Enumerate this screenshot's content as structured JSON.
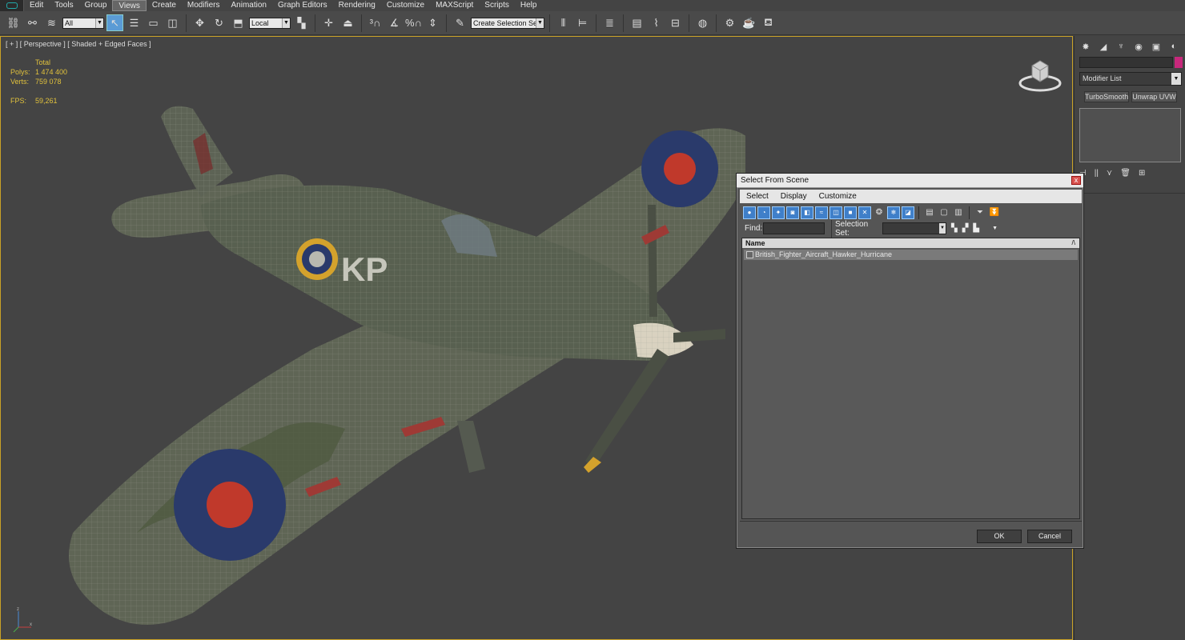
{
  "menu": {
    "items": [
      "Edit",
      "Tools",
      "Group",
      "Views",
      "Create",
      "Modifiers",
      "Animation",
      "Graph Editors",
      "Rendering",
      "Customize",
      "MAXScript",
      "Scripts",
      "Help"
    ],
    "active": "Views"
  },
  "toolbar": {
    "selection_filter": "All",
    "reference_coord": "Local",
    "selection_set_placeholder": "Create Selection Se"
  },
  "viewport": {
    "label": "[ + ] [ Perspective ] [ Shaded + Edged Faces ]",
    "stats": {
      "total_label": "Total",
      "polys_label": "Polys:",
      "polys_value": "1 474 400",
      "verts_label": "Verts:",
      "verts_value": "759 078",
      "fps_label": "FPS:",
      "fps_value": "59,261"
    },
    "fuselage_markings": "KP",
    "axis_labels": {
      "z": "z",
      "x": "x"
    }
  },
  "command_panel": {
    "modifier_list": "Modifier List",
    "modifier_buttons": [
      "TurboSmooth",
      "Unwrap UVW"
    ],
    "object_color": "#c8287c"
  },
  "dialog": {
    "title": "Select From Scene",
    "close": "x",
    "menu": [
      "Select",
      "Display",
      "Customize"
    ],
    "find_label": "Find:",
    "find_value": "",
    "selection_set_label": "Selection Set:",
    "selection_set_value": "",
    "list_header": "Name",
    "sort_indicator": "/\\",
    "rows": [
      "British_Fighter_Aircraft_Hawker_Hurricane"
    ],
    "ok_label": "OK",
    "cancel_label": "Cancel"
  },
  "colors": {
    "viewport_border": "#c9a227",
    "stats_text": "#e0c13c",
    "roundel_red": "#c0392b",
    "roundel_blue": "#2a3a6b",
    "roundel_yellow": "#d4a22c"
  }
}
